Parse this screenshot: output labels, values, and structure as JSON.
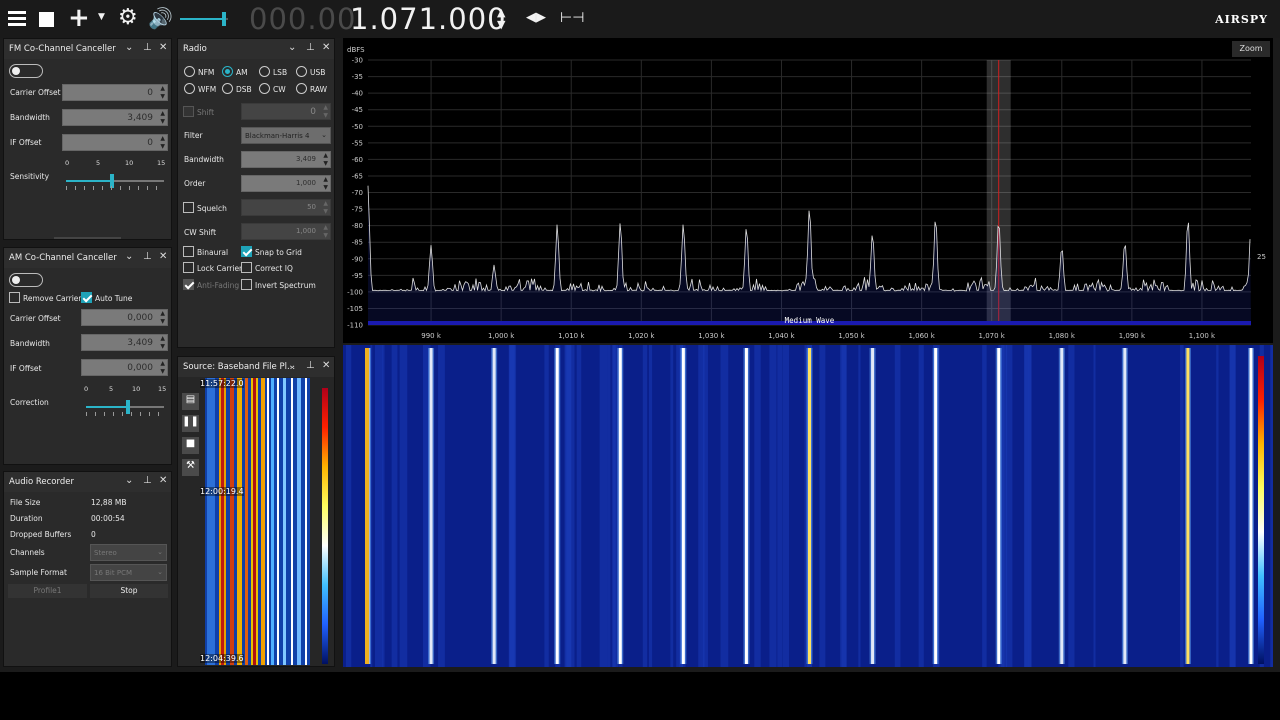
{
  "toolbar": {
    "freq_dim": "000.00",
    "freq": "1.071.000",
    "logo": "AIRSPY"
  },
  "fm_canceller": {
    "title": "FM Co-Channel Canceller",
    "rows": [
      {
        "label": "Carrier Offset",
        "value": "0"
      },
      {
        "label": "Bandwidth",
        "value": "3,409"
      },
      {
        "label": "IF Offset",
        "value": "0"
      }
    ],
    "sensitivity_label": "Sensitivity",
    "ticks": [
      "0",
      "5",
      "10",
      "15"
    ],
    "sensitivity_value": 7
  },
  "am_canceller": {
    "title": "AM Co-Channel Canceller",
    "remove_carrier": "Remove Carrier",
    "auto_tune": "Auto Tune",
    "rows": [
      {
        "label": "Carrier Offset",
        "value": "0,000"
      },
      {
        "label": "Bandwidth",
        "value": "3,409"
      },
      {
        "label": "IF Offset",
        "value": "0,000"
      }
    ],
    "correction_label": "Correction",
    "ticks": [
      "0",
      "5",
      "10",
      "15"
    ],
    "correction_value": 8
  },
  "audio_recorder": {
    "title": "Audio Recorder",
    "rows": [
      {
        "label": "File Size",
        "value": "12,88 MB"
      },
      {
        "label": "Duration",
        "value": "00:00:54"
      },
      {
        "label": "Dropped Buffers",
        "value": "0"
      }
    ],
    "channels_label": "Channels",
    "channels_value": "Stereo",
    "format_label": "Sample Format",
    "format_value": "16 Bit PCM",
    "profile_button": "Profile1",
    "stop_button": "Stop"
  },
  "radio": {
    "title": "Radio",
    "modes_row1": [
      "NFM",
      "AM",
      "LSB",
      "USB"
    ],
    "modes_row2": [
      "WFM",
      "DSB",
      "CW",
      "RAW"
    ],
    "selected_mode": "AM",
    "shift_label": "Shift",
    "shift_value": "0",
    "filter_label": "Filter",
    "filter_value": "Blackman-Harris 4",
    "bandwidth_label": "Bandwidth",
    "bandwidth_value": "3,409",
    "order_label": "Order",
    "order_value": "1,000",
    "squelch_label": "Squelch",
    "squelch_value": "50",
    "cwshift_label": "CW Shift",
    "cwshift_value": "1,000",
    "binaural": "Binaural",
    "snap": "Snap to Grid",
    "lock_carrier": "Lock Carrier",
    "correct_iq": "Correct IQ",
    "anti_fading": "Anti-Fading",
    "invert_spectrum": "Invert Spectrum"
  },
  "source": {
    "title": "Source: Baseband File Pl...",
    "times": [
      "11:57:22.0",
      "12:00:19.4",
      "12:04:39.6"
    ]
  },
  "spectrum": {
    "zoom": "Zoom",
    "ylabel": "dBFS",
    "band_label": "Medium Wave",
    "side_value": "25"
  },
  "chart_data": {
    "type": "line",
    "ylabel": "dBFS",
    "ylim": [
      -110,
      -30
    ],
    "yticks": [
      "-30",
      "-35",
      "-40",
      "-45",
      "-50",
      "-55",
      "-60",
      "-65",
      "-70",
      "-75",
      "-80",
      "-85",
      "-90",
      "-95",
      "-100",
      "-105",
      "-110"
    ],
    "xlim": [
      981,
      1107
    ],
    "xticks": [
      "990 k",
      "1,000 k",
      "1,010 k",
      "1,020 k",
      "1,030 k",
      "1,040 k",
      "1,050 k",
      "1,060 k",
      "1,070 k",
      "1,080 k",
      "1,090 k",
      "1,100 k"
    ],
    "xtick_values": [
      990,
      1000,
      1010,
      1020,
      1030,
      1040,
      1050,
      1060,
      1070,
      1080,
      1090,
      1100
    ],
    "grid": true,
    "noise_floor": -100,
    "peaks": [
      {
        "f": 981,
        "db": -68
      },
      {
        "f": 990,
        "db": -86
      },
      {
        "f": 999,
        "db": -92
      },
      {
        "f": 1008,
        "db": -80
      },
      {
        "f": 1017,
        "db": -79
      },
      {
        "f": 1026,
        "db": -79
      },
      {
        "f": 1035,
        "db": -80
      },
      {
        "f": 1044,
        "db": -74
      },
      {
        "f": 1053,
        "db": -82
      },
      {
        "f": 1062,
        "db": -77
      },
      {
        "f": 1071,
        "db": -78
      },
      {
        "f": 1080,
        "db": -86
      },
      {
        "f": 1089,
        "db": -85
      },
      {
        "f": 1098,
        "db": -78
      },
      {
        "f": 1107,
        "db": -80
      }
    ],
    "selected_freq": 1071
  },
  "colors": {
    "accent": "#2bb4c8",
    "panel": "#2a2a2a",
    "waterfall_bg": "#0a1f8a"
  }
}
